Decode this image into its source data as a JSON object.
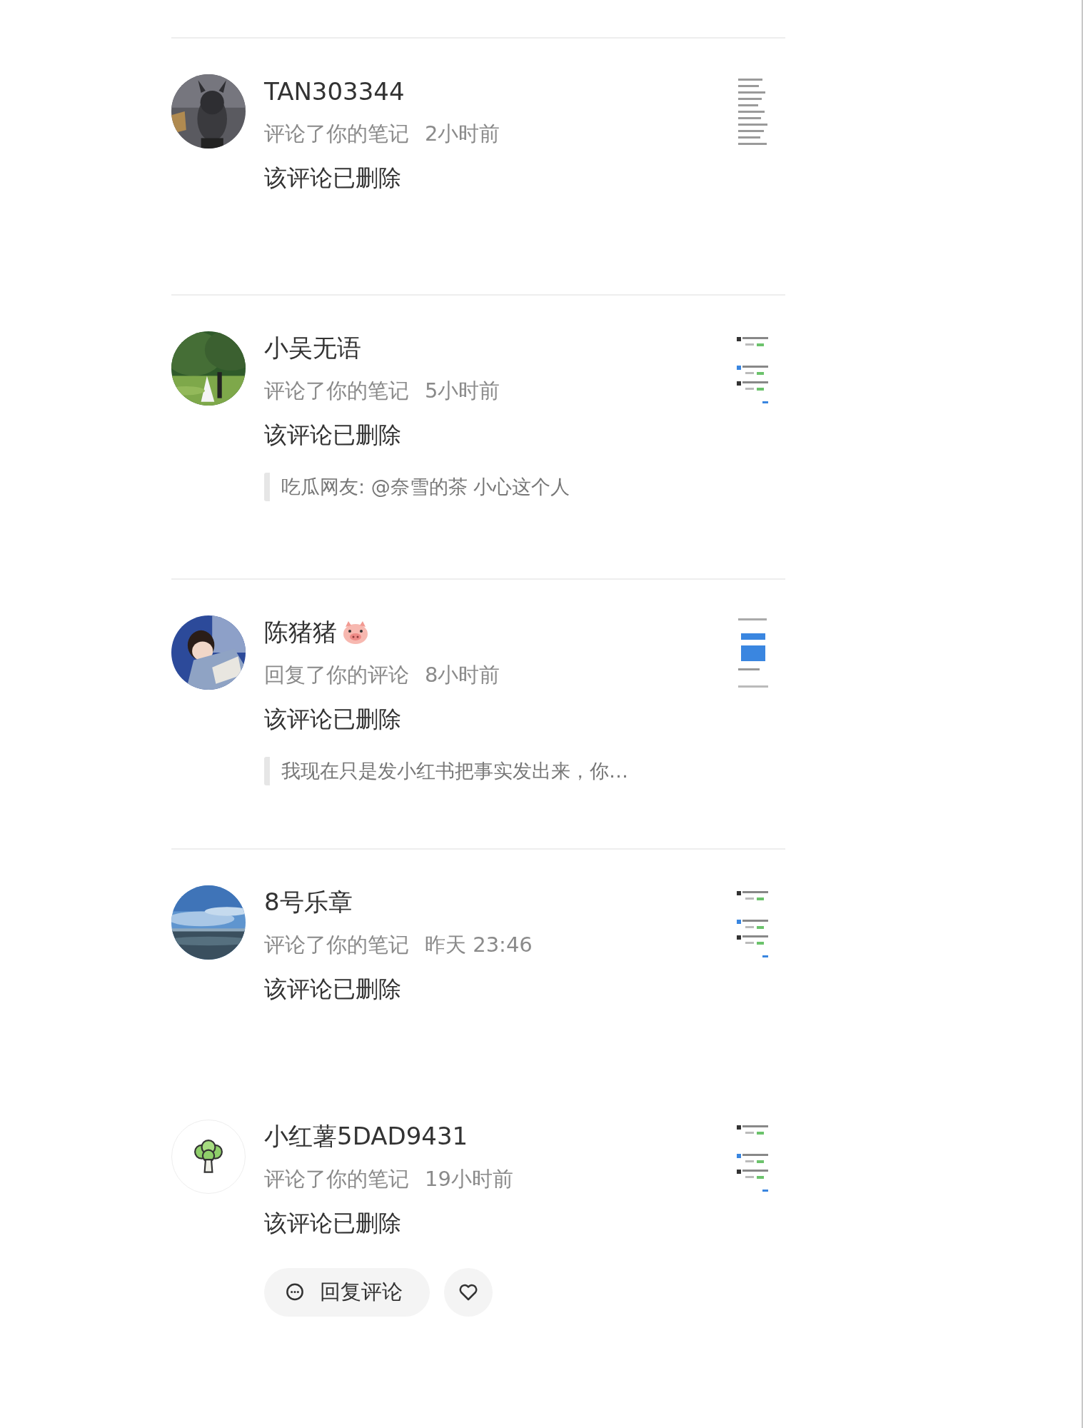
{
  "notifications": [
    {
      "name": "TAN303344",
      "action": "评论了你的笔记",
      "time": "2小时前",
      "content": "该评论已删除"
    },
    {
      "name": "小吴无语",
      "action": "评论了你的笔记",
      "time": "5小时前",
      "content": "该评论已删除",
      "quote": "吃瓜网友: @奈雪的茶 小心这个人"
    },
    {
      "name": "陈猪猪",
      "name_badge": {
        "kind": "pig"
      },
      "action": "回复了你的评论",
      "time": "8小时前",
      "content": "该评论已删除",
      "quote": "我现在只是发小红书把事实发出来，你…"
    },
    {
      "name": "8号乐章",
      "action": "评论了你的笔记",
      "time": "昨天 23:46",
      "content": "该评论已删除"
    },
    {
      "avatar": {
        "kind": "broccoli"
      },
      "name": "小红薯5DAD9431",
      "action": "评论了你的笔记",
      "time": "19小时前",
      "content": "该评论已删除",
      "reply_button": "回复评论",
      "like_button": true
    }
  ]
}
